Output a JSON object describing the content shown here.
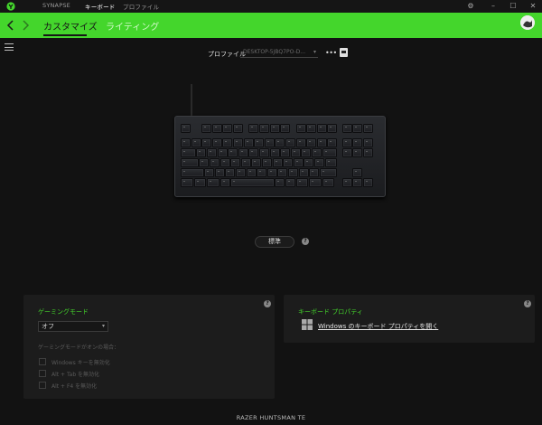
{
  "titlebar": {
    "tabs": [
      "SYNAPSE",
      "キーボード",
      "プロファイル"
    ],
    "active_tab": 1
  },
  "header": {
    "tabs": [
      "カスタマイズ",
      "ライティング"
    ],
    "active_tab": 0,
    "accent": "#44d62c"
  },
  "profile": {
    "label": "プロファイル",
    "value": "DESKTOP-5JBQ7PO-D...",
    "more": "•••"
  },
  "keyboard": {
    "standard_button": "標準",
    "help": "?"
  },
  "gaming_mode": {
    "title": "ゲーミングモード",
    "selected": "オフ",
    "note": "ゲーミングモードがオンの場合：",
    "options": [
      "Windows キーを無効化",
      "Alt + Tab を無効化",
      "Alt + F4 を無効化"
    ],
    "help": "?"
  },
  "keyboard_properties": {
    "title": "キーボード プロパティ",
    "link": "Windows のキーボード プロパティを開く",
    "help": "?"
  },
  "footer": {
    "device_name": "RAZER HUNTSMAN TE"
  }
}
